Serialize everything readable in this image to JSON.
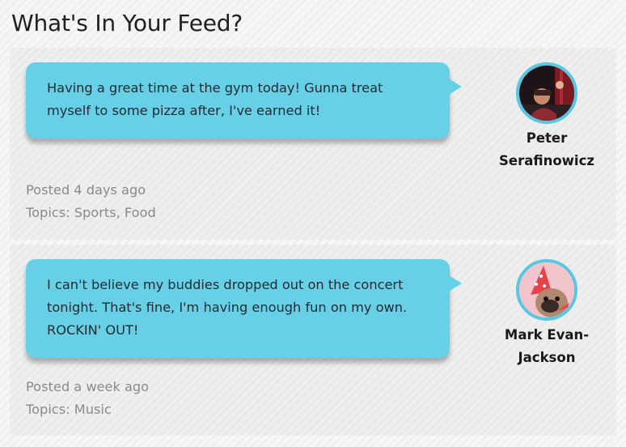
{
  "page": {
    "title": "What's In Your Feed?"
  },
  "colors": {
    "bubble": "#67d0e6",
    "avatar_ring": "#5ac6e2",
    "meta_text": "#8a8a8a"
  },
  "posts": [
    {
      "message": "Having a great time at the gym today! Gunna treat myself to some pizza after, I've earned it!",
      "posted": "Posted 4 days ago",
      "topics": "Topics: Sports, Food",
      "author": {
        "name": "Peter Serafinowicz"
      }
    },
    {
      "message": "I can't believe my buddies dropped out on the concert tonight. That's fine, I'm having enough fun on my own. ROCKIN' OUT!",
      "posted": "Posted a week ago",
      "topics": "Topics: Music",
      "author": {
        "name": "Mark Evan-Jackson"
      }
    }
  ]
}
